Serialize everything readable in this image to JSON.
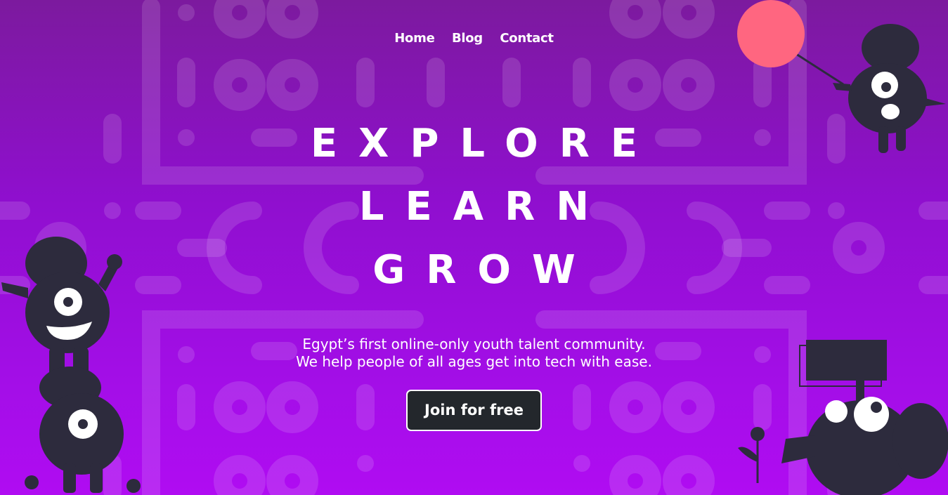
{
  "nav": {
    "items": [
      {
        "label": "Home"
      },
      {
        "label": "Blog"
      },
      {
        "label": "Contact"
      }
    ]
  },
  "hero": {
    "lines": [
      "EXPLORE",
      "LEARN",
      "GROW"
    ],
    "tagline": [
      "Egypt’s first online-only youth talent community.",
      "We help people of all ages get into tech with ease."
    ],
    "cta_label": "Join for free"
  },
  "colors": {
    "background_top": "#7c1a9e",
    "background_bottom": "#b00cf2",
    "character": "#2d2b3d",
    "balloon": "#ff6680",
    "button": "#23272c"
  },
  "icons": [
    "monster-with-balloon-icon",
    "stacked-monsters-icon",
    "monster-with-sign-icon",
    "flower-icon"
  ]
}
